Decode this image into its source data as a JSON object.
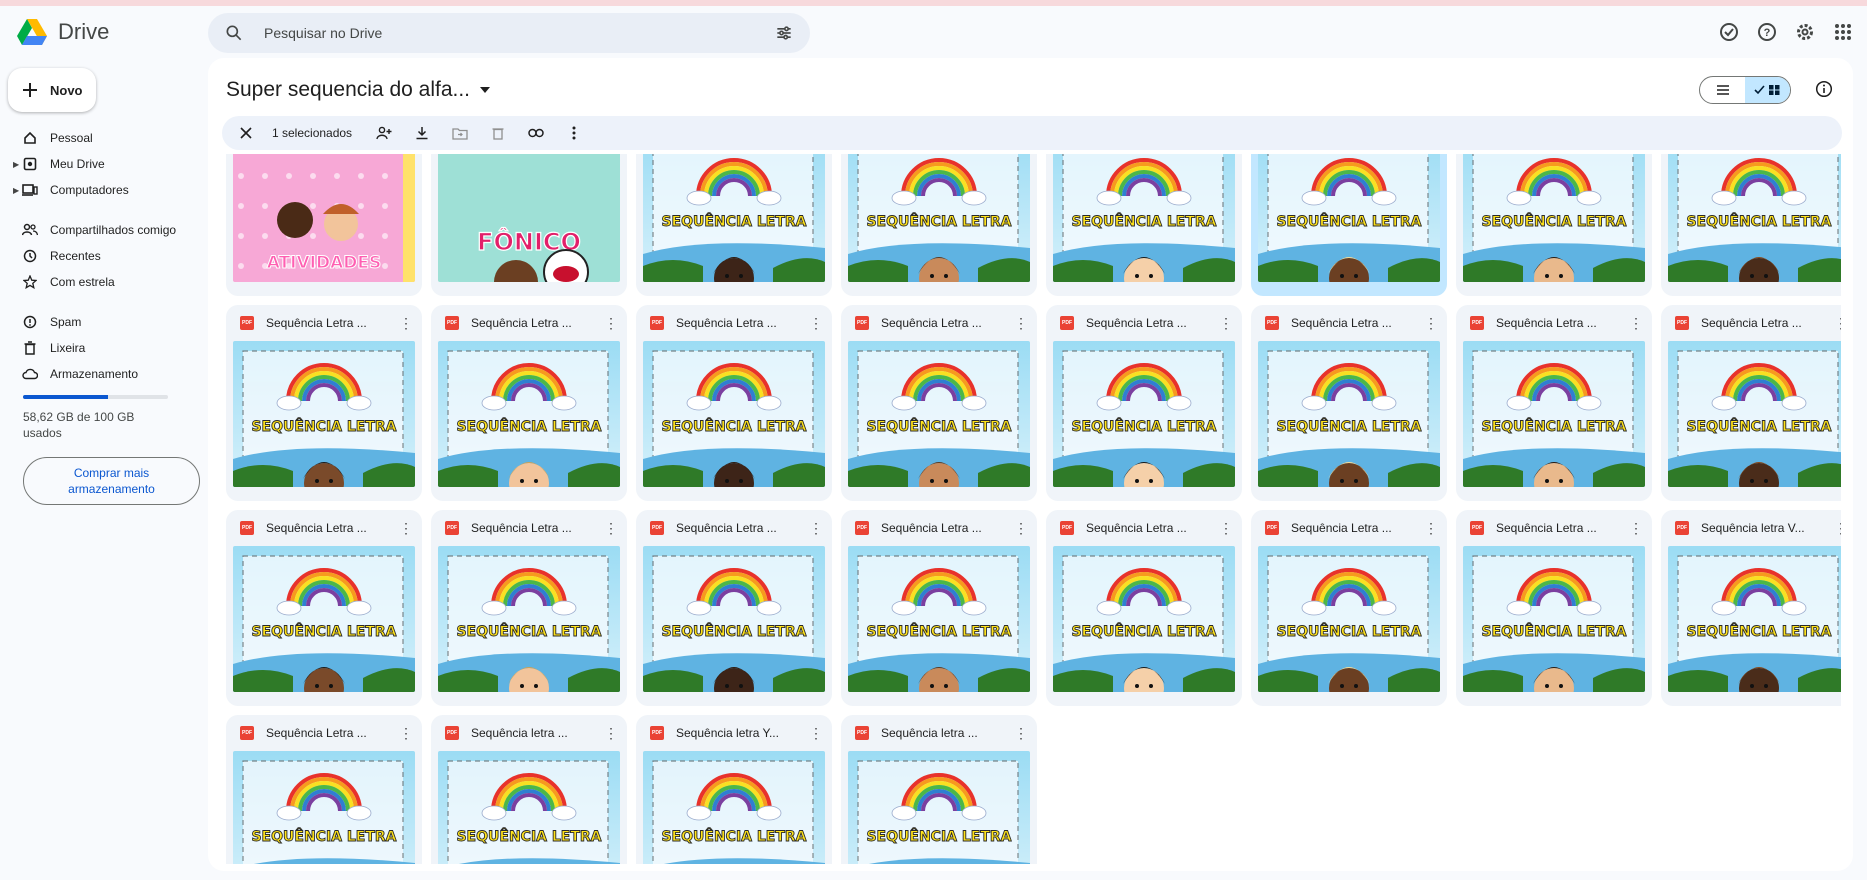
{
  "app": {
    "name": "Drive"
  },
  "search": {
    "placeholder": "Pesquisar no Drive"
  },
  "new_button": {
    "label": "Novo"
  },
  "sidebar": {
    "items": [
      {
        "label": "Pessoal",
        "icon": "home-icon"
      },
      {
        "label": "Meu Drive",
        "icon": "drive-icon",
        "expandable": true
      },
      {
        "label": "Computadores",
        "icon": "computer-icon",
        "expandable": true
      },
      {
        "label": "Compartilhados comigo",
        "icon": "people-icon"
      },
      {
        "label": "Recentes",
        "icon": "clock-icon"
      },
      {
        "label": "Com estrela",
        "icon": "star-icon"
      },
      {
        "label": "Spam",
        "icon": "spam-icon"
      },
      {
        "label": "Lixeira",
        "icon": "trash-icon"
      },
      {
        "label": "Armazenamento",
        "icon": "cloud-icon"
      }
    ]
  },
  "storage": {
    "used_fraction": 0.5862,
    "text": "58,62 GB de 100 GB usados",
    "buy_label": "Comprar mais armazenamento"
  },
  "folder": {
    "title": "Super sequencia do alfa..."
  },
  "selection": {
    "text": "1 selecionados"
  },
  "colors": {
    "accent": "#0b57d0",
    "selected": "#c2e7ff",
    "pdf": "#ea4335"
  },
  "cards": [
    {
      "name": "",
      "thumb": "atividades"
    },
    {
      "name": "",
      "thumb": "fonico"
    },
    {
      "name": "",
      "thumb": "kid"
    },
    {
      "name": "",
      "thumb": "kid"
    },
    {
      "name": "",
      "thumb": "kid"
    },
    {
      "name": "",
      "thumb": "kid",
      "selected": true
    },
    {
      "name": "",
      "thumb": "kid"
    },
    {
      "name": "",
      "thumb": "kid"
    },
    {
      "name": "Sequência Letra ...",
      "thumb": "kid"
    },
    {
      "name": "Sequência Letra ...",
      "thumb": "kid"
    },
    {
      "name": "Sequência Letra ...",
      "thumb": "kid"
    },
    {
      "name": "Sequência Letra ...",
      "thumb": "kid"
    },
    {
      "name": "Sequência Letra ...",
      "thumb": "kid"
    },
    {
      "name": "Sequência Letra ...",
      "thumb": "kid"
    },
    {
      "name": "Sequência Letra ...",
      "thumb": "kid"
    },
    {
      "name": "Sequência Letra ...",
      "thumb": "kid"
    },
    {
      "name": "Sequência Letra ...",
      "thumb": "kid"
    },
    {
      "name": "Sequência Letra ...",
      "thumb": "kid"
    },
    {
      "name": "Sequência Letra ...",
      "thumb": "kid"
    },
    {
      "name": "Sequência Letra ...",
      "thumb": "kid"
    },
    {
      "name": "Sequência Letra ...",
      "thumb": "kid"
    },
    {
      "name": "Sequência Letra ...",
      "thumb": "kid"
    },
    {
      "name": "Sequência Letra ...",
      "thumb": "kid"
    },
    {
      "name": "Sequência letra V...",
      "thumb": "kid"
    },
    {
      "name": "Sequência Letra ...",
      "thumb": "kid"
    },
    {
      "name": "Sequência letra ...",
      "thumb": "kid"
    },
    {
      "name": "Sequência letra Y...",
      "thumb": "kid"
    },
    {
      "name": "Sequência letra ...",
      "thumb": "kid"
    }
  ],
  "thumb_text": {
    "sequencia": "SEQUÊNCIA LETRA",
    "atividades": "ATIVIDADES",
    "fonico": "FÔNICO"
  }
}
